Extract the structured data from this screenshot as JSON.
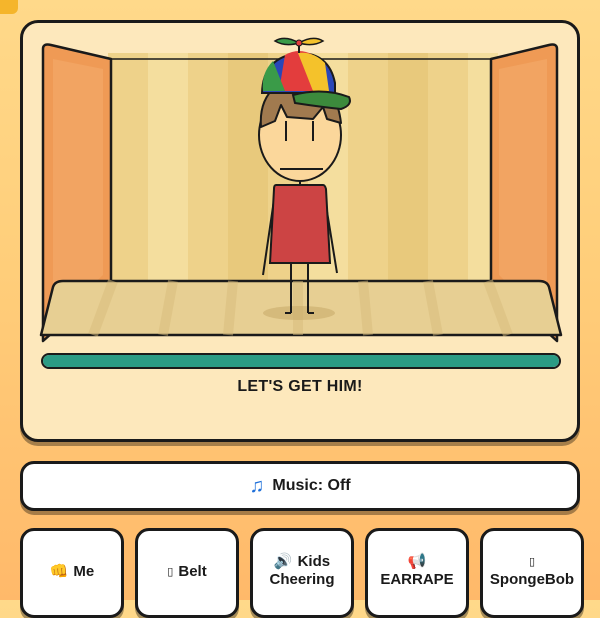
{
  "stage": {
    "caption": "LET'S GET HIM!",
    "progress_percent": 100
  },
  "music": {
    "icon": "music-note-icon",
    "label": "Music: Off"
  },
  "sounds": [
    {
      "icon": "punch-icon",
      "glyph": "👊",
      "label": "Me",
      "lines": [
        "Me"
      ]
    },
    {
      "icon": "belt-icon",
      "glyph": "▯",
      "label": "Belt",
      "lines": [
        "Belt"
      ]
    },
    {
      "icon": "speaker-icon",
      "glyph": "🔊",
      "label": "Kids Cheering",
      "lines": [
        "Kids",
        "Cheering"
      ]
    },
    {
      "icon": "megaphone-icon",
      "glyph": "📢",
      "label": "EARRAPE",
      "lines": [
        "EARRAPE"
      ]
    },
    {
      "icon": "spongebob-icon",
      "glyph": "▯",
      "label": "SpongeBob",
      "lines": [
        "SpongeBob"
      ]
    }
  ],
  "colors": {
    "background": "#ffd27f",
    "card": "#fde8bc",
    "progress": "#2b9b84",
    "curtain": "#ef9a55",
    "shirt": "#cc4444"
  }
}
